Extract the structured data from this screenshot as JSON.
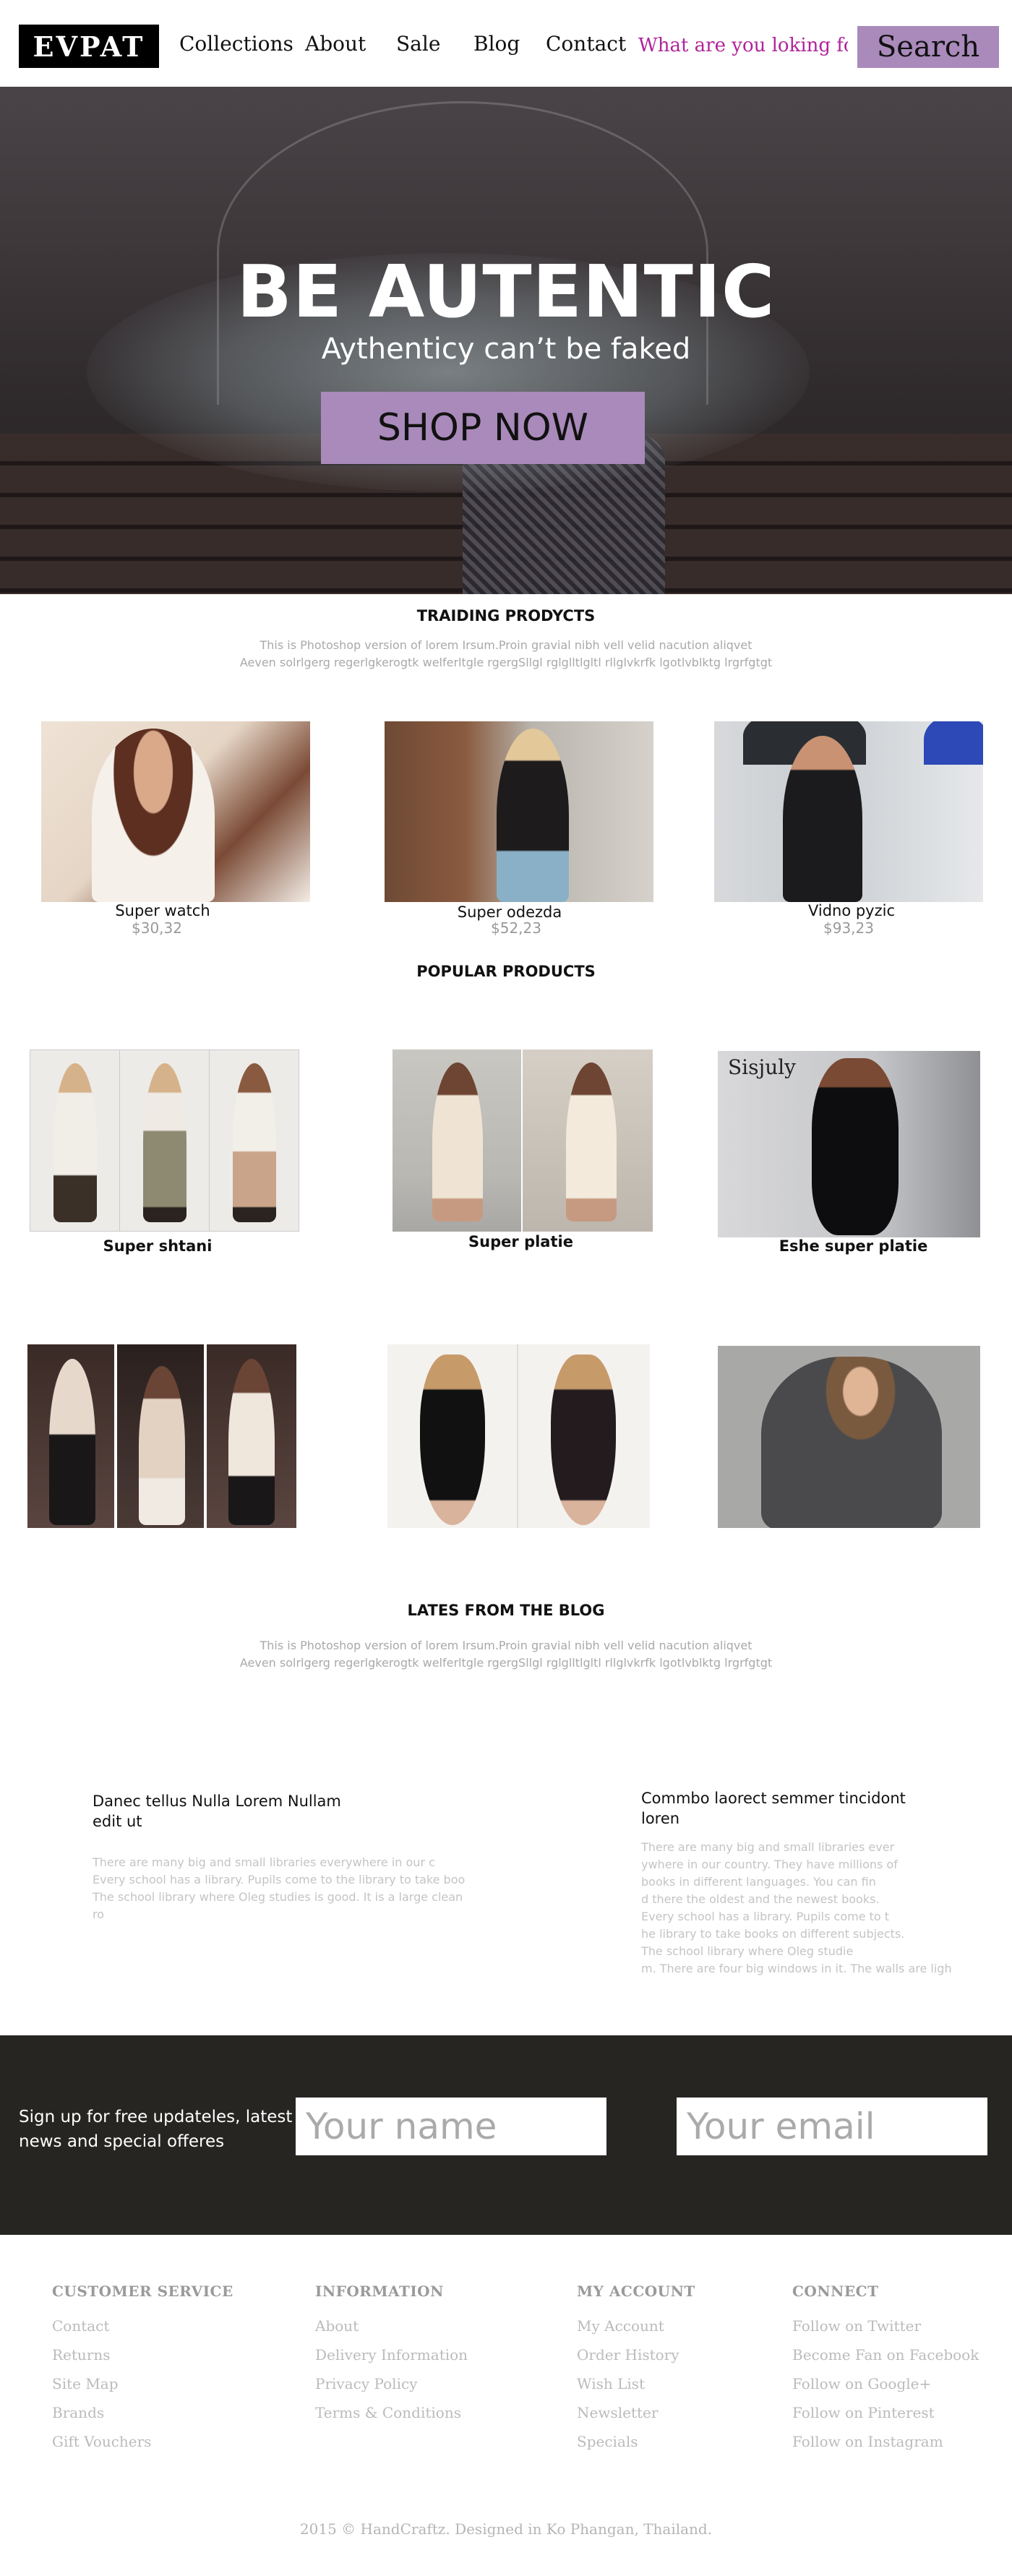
{
  "header": {
    "logo": "EVPAT",
    "nav": [
      "Collections",
      "About",
      "Sale",
      "Blog",
      "Contact"
    ],
    "search_placeholder": "What are you loking for",
    "search_button": "Search",
    "accent_color": "#a98abb",
    "search_text_color": "#b0249a"
  },
  "hero": {
    "title": "BE AUTENTIC",
    "subtitle": "Aythenticy can’t be faked",
    "cta": "SHOP NOW"
  },
  "trending": {
    "title": "TRAIDING PRODYCTS",
    "desc_line1": "This is Photoshop version of lorem Irsum.Proin gravial nibh vell velid nacution aliqvet",
    "desc_line2": "Aeven solrlgerg regerlgkerogtk welferltgle rgergSllgl rglglltlgltl rllglvkrfk lgotlvblktg lrgrfgtgt",
    "products": [
      {
        "name": "Super watch",
        "price": "$30,32"
      },
      {
        "name": "Super odezda",
        "price": "$52,23"
      },
      {
        "name": "Vidno pyzic",
        "price": "$93,23"
      }
    ]
  },
  "popular": {
    "title": "POPULAR PRODUCTS",
    "products": [
      {
        "name": "Super shtani"
      },
      {
        "name": "Super platie"
      },
      {
        "name": "Eshe super platie",
        "image_text": "Sisjuly"
      }
    ]
  },
  "blog": {
    "title": "LATES FROM THE BLOG",
    "desc_line1": "This is Photoshop version of lorem Irsum.Proin gravial nibh vell velid nacution aliqvet",
    "desc_line2": "Aeven solrlgerg regerlgkerogtk welferltgle rgergSllgl rglglltlgltl rllglvkrfk lgotlvblktg lrgrfgtgt",
    "posts": [
      {
        "title_line1": "Danec tellus Nulla Lorem Nullam",
        "title_line2": "edit ut",
        "body": [
          "There are many big and small libraries everywhere in our c",
          "Every school has a library. Pupils come to the library to take boo",
          "The school library where Oleg studies is good. It is a large clean ro"
        ]
      },
      {
        "title_line1": "Commbo laorect semmer tincidont",
        "title_line2": "loren",
        "body": [
          "There are many big and small libraries ever",
          "ywhere in our country. They have millions of",
          "books in different languages. You can fin",
          "d there the oldest and the newest books.",
          "Every school has a library. Pupils come to t",
          "he library to take books on different subjects.",
          "The school library where Oleg studie",
          "m. There are four big windows in it. The walls are ligh"
        ]
      }
    ]
  },
  "newsletter": {
    "text_line1": "Sign up for free updateles, latest",
    "text_line2": "news and special offeres",
    "name_placeholder": "Your name",
    "email_placeholder": "Your email",
    "background": "#272522"
  },
  "footer": {
    "columns": [
      {
        "heading": "CUSTOMER SERVICE",
        "links": [
          "Contact",
          "Returns",
          "Site Map",
          "Brands",
          "Gift Vouchers"
        ]
      },
      {
        "heading": "INFORMATION",
        "links": [
          "About",
          "Delivery Information",
          "Privacy Policy",
          "Terms & Conditions"
        ]
      },
      {
        "heading": "MY ACCOUNT",
        "links": [
          "My Account",
          "Order History",
          "Wish List",
          "Newsletter",
          "Specials"
        ]
      },
      {
        "heading": "CONNECT",
        "links": [
          "Follow on Twitter",
          "Become Fan on Facebook",
          "Follow on Google+",
          "Follow on Pinterest",
          "Follow on Instagram"
        ]
      }
    ],
    "copyright": "2015 © HandCraftz. Designed in Ko Phangan, Thailand."
  }
}
